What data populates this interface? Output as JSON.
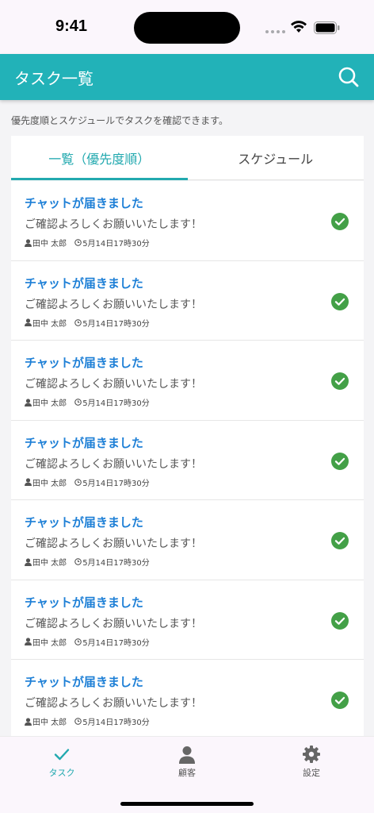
{
  "status_bar": {
    "time": "9:41"
  },
  "header": {
    "title": "タスク一覧"
  },
  "subtitle": "優先度順とスケジュールでタスクを確認できます。",
  "tabs": [
    {
      "label": "一覧（優先度順）",
      "active": true
    },
    {
      "label": "スケジュール",
      "active": false
    }
  ],
  "tasks": [
    {
      "title": "チャットが届きました",
      "body": "ご確認よろしくお願いいたします！",
      "user": "田中 太郎",
      "time": "5月14日17時30分",
      "done": true
    },
    {
      "title": "チャットが届きました",
      "body": "ご確認よろしくお願いいたします！",
      "user": "田中 太郎",
      "time": "5月14日17時30分",
      "done": true
    },
    {
      "title": "チャットが届きました",
      "body": "ご確認よろしくお願いいたします！",
      "user": "田中 太郎",
      "time": "5月14日17時30分",
      "done": true
    },
    {
      "title": "チャットが届きました",
      "body": "ご確認よろしくお願いいたします！",
      "user": "田中 太郎",
      "time": "5月14日17時30分",
      "done": true
    },
    {
      "title": "チャットが届きました",
      "body": "ご確認よろしくお願いいたします！",
      "user": "田中 太郎",
      "time": "5月14日17時30分",
      "done": true
    },
    {
      "title": "チャットが届きました",
      "body": "ご確認よろしくお願いいたします！",
      "user": "田中 太郎",
      "time": "5月14日17時30分",
      "done": true
    },
    {
      "title": "チャットが届きました",
      "body": "ご確認よろしくお願いいたします！",
      "user": "田中 太郎",
      "time": "5月14日17時30分",
      "done": true
    }
  ],
  "tabbar": [
    {
      "label": "タスク",
      "icon": "check-icon",
      "active": true
    },
    {
      "label": "顧客",
      "icon": "person-icon",
      "active": false
    },
    {
      "label": "設定",
      "icon": "gear-icon",
      "active": false
    }
  ],
  "colors": {
    "accent": "#22b2b8",
    "link": "#1d7fd6",
    "check": "#43a047"
  }
}
